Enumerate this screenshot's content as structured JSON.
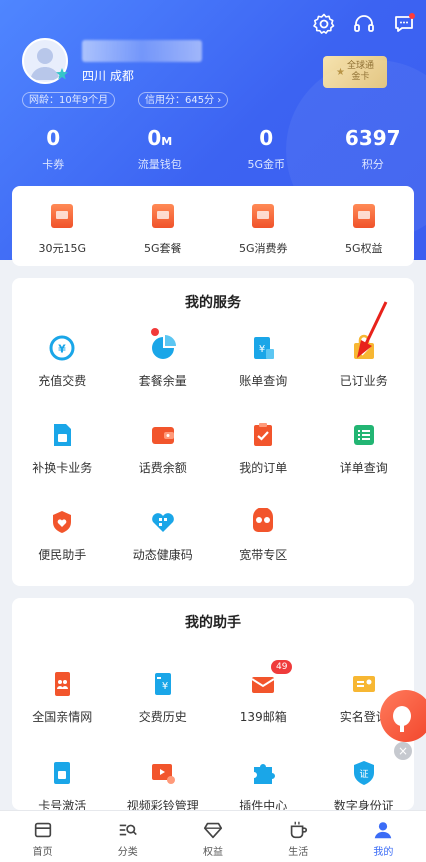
{
  "header": {
    "location": "四川 成都",
    "net_age": "网龄：10年9个月",
    "credit": "信用分：645分",
    "vip_card": {
      "line1": "全球通",
      "line2": "金卡"
    },
    "stats": [
      {
        "value": "0",
        "unit": "",
        "label": "卡券"
      },
      {
        "value": "0",
        "unit": "M",
        "label": "流量钱包"
      },
      {
        "value": "0",
        "unit": "",
        "label": "5G金币"
      },
      {
        "value": "6397",
        "unit": "",
        "label": "积分"
      }
    ]
  },
  "quick": [
    {
      "label": "30元15G",
      "icon": "train-ticket-icon"
    },
    {
      "label": "5G套餐",
      "icon": "phone-card-icon"
    },
    {
      "label": "5G消费券",
      "icon": "coupon-icon"
    },
    {
      "label": "5G权益",
      "icon": "gift-icon"
    }
  ],
  "services": {
    "title": "我的服务",
    "items": [
      {
        "label": "充值交费",
        "icon": "recharge-icon"
      },
      {
        "label": "套餐余量",
        "icon": "pie-chart-icon"
      },
      {
        "label": "账单查询",
        "icon": "bill-icon"
      },
      {
        "label": "已订业务",
        "icon": "bag-check-icon"
      },
      {
        "label": "补换卡业务",
        "icon": "sim-card-icon"
      },
      {
        "label": "话费余额",
        "icon": "wallet-icon"
      },
      {
        "label": "我的订单",
        "icon": "order-icon"
      },
      {
        "label": "详单查询",
        "icon": "list-icon"
      },
      {
        "label": "便民助手",
        "icon": "helper-icon"
      },
      {
        "label": "动态健康码",
        "icon": "health-code-icon"
      },
      {
        "label": "宽带专区",
        "icon": "broadband-icon"
      }
    ]
  },
  "assistant": {
    "title": "我的助手",
    "items": [
      {
        "label": "全国亲情网",
        "icon": "family-icon"
      },
      {
        "label": "交费历史",
        "icon": "payment-history-icon"
      },
      {
        "label": "139邮箱",
        "icon": "mail-icon",
        "badge": "49"
      },
      {
        "label": "实名登记",
        "icon": "id-card-icon"
      },
      {
        "label": "卡号激活",
        "icon": "activate-icon"
      },
      {
        "label": "视频彩铃管理",
        "icon": "video-ringtone-icon"
      },
      {
        "label": "插件中心",
        "icon": "plugin-icon"
      },
      {
        "label": "数字身份证",
        "icon": "digital-id-icon"
      }
    ]
  },
  "tabbar": [
    {
      "label": "首页",
      "icon": "home-icon"
    },
    {
      "label": "分类",
      "icon": "category-search-icon"
    },
    {
      "label": "权益",
      "icon": "diamond-icon"
    },
    {
      "label": "生活",
      "icon": "cup-icon"
    },
    {
      "label": "我的",
      "icon": "profile-icon",
      "active": true
    }
  ],
  "colors": {
    "primary": "#3b6cf6",
    "accent_orange": "#f2552c",
    "accent_teal": "#1aa6e8",
    "badge_red": "#ef3b3b"
  }
}
